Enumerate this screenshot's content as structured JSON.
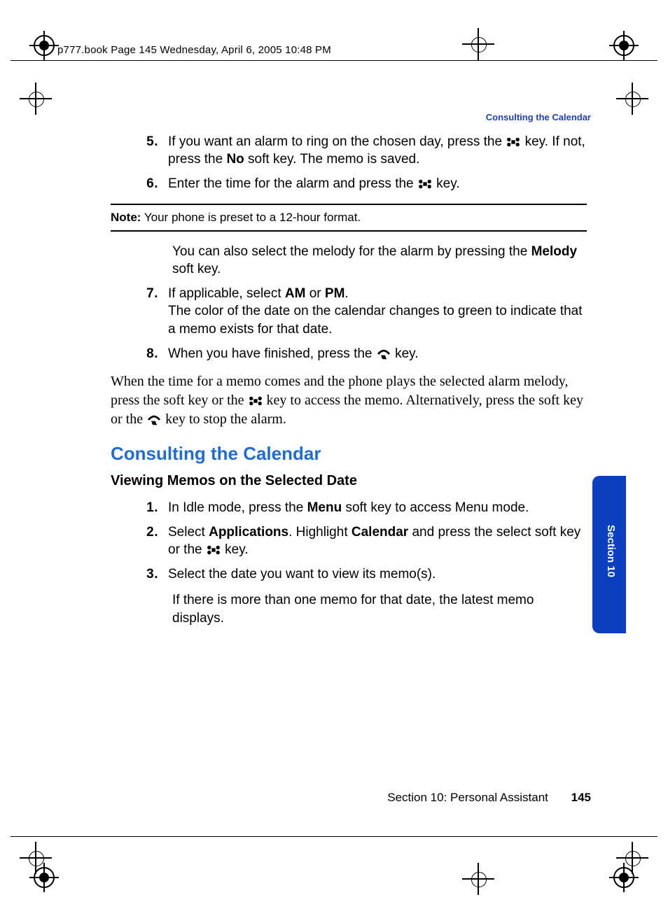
{
  "header_slug": "p777.book  Page 145  Wednesday, April 6, 2005  10:48 PM",
  "running_head": "Consulting the Calendar",
  "steps_a": [
    {
      "n": "5.",
      "t_before": "If you want an alarm to ring on the chosen day, press the ",
      "t_mid": " key. If not, press the ",
      "b1": "No",
      "t_after": " soft key. The memo is saved.",
      "icon": "ok"
    },
    {
      "n": "6.",
      "t_before": "Enter the time for the alarm and press the ",
      "t_after": " key.",
      "icon": "ok"
    }
  ],
  "note_label": "Note:",
  "note_text": " Your phone is preset to a 12-hour format.",
  "after_note_1a": "You can also select the melody for the alarm by pressing the ",
  "after_note_1b": "Melody",
  "after_note_1c": " soft key.",
  "steps_b": [
    {
      "n": "7.",
      "parts": [
        {
          "t": "If applicable, select "
        },
        {
          "b": "AM"
        },
        {
          "t": " or "
        },
        {
          "b": "PM"
        },
        {
          "t": "."
        },
        {
          "br": true
        },
        {
          "t": "The color of the date on the calendar changes to green to indicate that a memo exists for that date."
        }
      ]
    },
    {
      "n": "8.",
      "parts": [
        {
          "t": "When you have finished, press the "
        },
        {
          "icon": "end"
        },
        {
          "t": " key."
        }
      ]
    }
  ],
  "serif_para": [
    {
      "t": "When the time for a memo comes and the phone plays the selected alarm melody, press the          soft key or the "
    },
    {
      "icon": "ok"
    },
    {
      "t": " key to access the memo. Alternatively, press the         soft key or the "
    },
    {
      "icon": "end"
    },
    {
      "t": " key to stop the alarm."
    }
  ],
  "h2": "Consulting the Calendar",
  "h3": "Viewing Memos on the Selected Date",
  "steps_c": [
    {
      "n": "1.",
      "parts": [
        {
          "t": "In Idle mode, press the "
        },
        {
          "b": "Menu"
        },
        {
          "t": " soft key to access Menu mode."
        }
      ]
    },
    {
      "n": "2.",
      "parts": [
        {
          "t": "Select "
        },
        {
          "b": "Applications"
        },
        {
          "t": ". Highlight "
        },
        {
          "b": "Calendar"
        },
        {
          "t": " and press the select soft key or the "
        },
        {
          "icon": "ok"
        },
        {
          "t": " key."
        }
      ]
    },
    {
      "n": "3.",
      "parts": [
        {
          "t": "Select the date you want to view its memo(s)."
        }
      ]
    }
  ],
  "sub_after": "If there is more than one memo for that date, the latest memo displays.",
  "footer_section": "Section 10: Personal Assistant",
  "footer_page": "145",
  "side_tab": "Section 10"
}
